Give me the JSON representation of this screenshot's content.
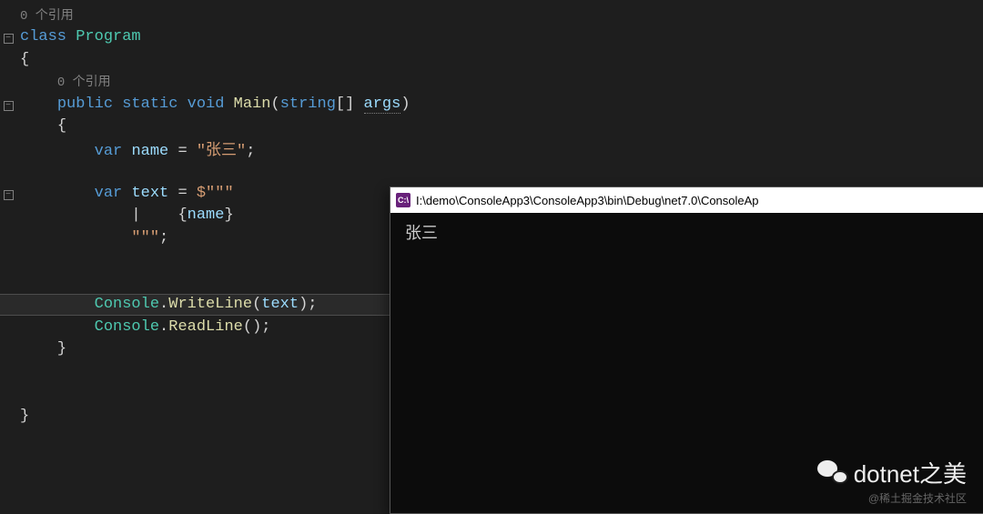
{
  "editor": {
    "ref0": "0 个引用",
    "kw_class": "class",
    "type_program": "Program",
    "brace_open": "{",
    "ref1": "0 个引用",
    "kw_public": "public",
    "kw_static": "static",
    "kw_void": "void",
    "method_main": "Main",
    "paren_open": "(",
    "kw_string": "string",
    "brackets": "[]",
    "param_args": "args",
    "paren_close": ")",
    "brace_open2": "{",
    "kw_var1": "var",
    "local_name": "name",
    "eq": " = ",
    "str_zhangsan": "\"张三\"",
    "semi": ";",
    "kw_var2": "var",
    "local_text": "text",
    "eq2": " = ",
    "raw_open": "$\"\"\"",
    "pipe": "|",
    "interp_open": "{",
    "interp_name": "name",
    "interp_close": "}",
    "raw_close": "\"\"\"",
    "console1": "Console",
    "dot": ".",
    "writeline": "WriteLine",
    "wl_arg": "text",
    "console2": "Console",
    "readline": "ReadLine",
    "brace_close2": "}",
    "brace_close": "}"
  },
  "console": {
    "icon": "C:\\",
    "title": "I:\\demo\\ConsoleApp3\\ConsoleApp3\\bin\\Debug\\net7.0\\ConsoleAp",
    "output": "    张三"
  },
  "watermark": {
    "text": "dotnet之美",
    "sub": "@稀土掘金技术社区"
  }
}
